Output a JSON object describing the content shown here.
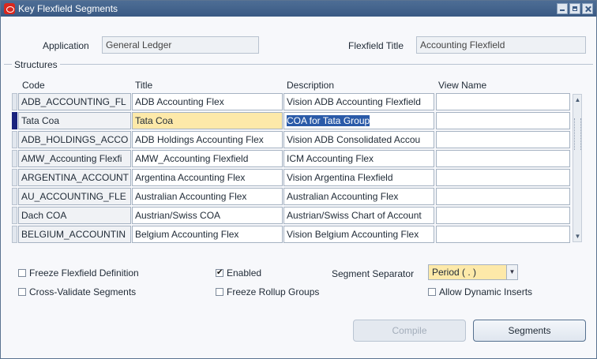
{
  "window": {
    "title": "Key Flexfield Segments"
  },
  "header": {
    "application_label": "Application",
    "application_value": "General Ledger",
    "flexfield_title_label": "Flexfield Title",
    "flexfield_title_value": "Accounting Flexfield"
  },
  "structures": {
    "group_title": "Structures",
    "columns": {
      "code": "Code",
      "title": "Title",
      "description": "Description",
      "view_name": "View Name"
    },
    "rows": [
      {
        "code": "ADB_ACCOUNTING_FL",
        "title": "ADB Accounting Flex",
        "description": "Vision ADB Accounting Flexfield",
        "view_name": ""
      },
      {
        "code": "Tata Coa",
        "title": "Tata Coa",
        "description": "COA for Tata Group",
        "view_name": ""
      },
      {
        "code": "ADB_HOLDINGS_ACCO",
        "title": "ADB Holdings Accounting Flex",
        "description": "Vision ADB Consolidated Accou",
        "view_name": ""
      },
      {
        "code": "AMW_Accounting Flexfi",
        "title": "AMW_Accounting Flexfield",
        "description": "ICM Accounting Flex",
        "view_name": ""
      },
      {
        "code": "ARGENTINA_ACCOUNT",
        "title": "Argentina Accounting Flex",
        "description": "Vision Argentina Flexfield",
        "view_name": ""
      },
      {
        "code": "AU_ACCOUNTING_FLE",
        "title": "Australian Accounting Flex",
        "description": "Australian Accounting Flex",
        "view_name": ""
      },
      {
        "code": "Dach COA",
        "title": "Austrian/Swiss COA",
        "description": "Austrian/Swiss Chart of Account",
        "view_name": ""
      },
      {
        "code": "BELGIUM_ACCOUNTIN",
        "title": "Belgium Accounting Flex",
        "description": "Vision Belgium Accounting Flex",
        "view_name": ""
      }
    ]
  },
  "options": {
    "freeze_definition": {
      "label": "Freeze Flexfield Definition",
      "checked": false
    },
    "enabled": {
      "label": "Enabled",
      "checked": true
    },
    "segment_separator_label": "Segment Separator",
    "segment_separator_value": "Period ( . )",
    "cross_validate": {
      "label": "Cross-Validate Segments",
      "checked": false
    },
    "freeze_rollup": {
      "label": "Freeze Rollup Groups",
      "checked": false
    },
    "allow_dynamic": {
      "label": "Allow Dynamic Inserts",
      "checked": false
    }
  },
  "buttons": {
    "compile": "Compile",
    "segments": "Segments"
  },
  "colors": {
    "titlebar": "#3a5a84",
    "active_field": "#fde9a9",
    "selection": "#2a5aa8",
    "row_indicator": "#1a237e"
  }
}
